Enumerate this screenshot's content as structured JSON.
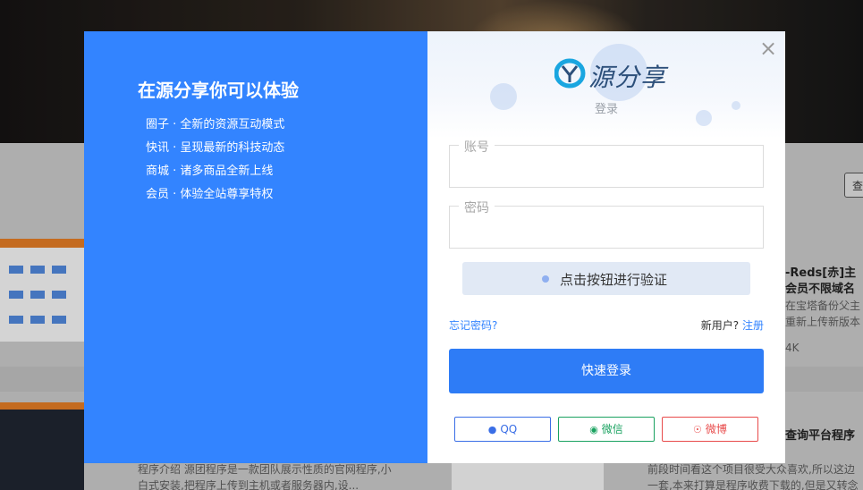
{
  "background": {
    "right_title_1": "-Reds[赤]主",
    "right_title_1b": "会员不限域名",
    "right_snippet_1": "在宝塔备份父主",
    "right_snippet_1b": "重新上传新版本",
    "right_stat": "4K",
    "right_title_2": "查询平台程序",
    "bottom_text_left_1": "程序介绍 源团程序是一款团队展示性质的官网程序,小",
    "bottom_text_left_2": "白式安装,把程序上传到主机或者服务器内,设...",
    "bottom_text_right_1": "前段时间看这个项目很受大众喜欢,所以这边",
    "bottom_text_right_2": "一套,本来打算是程序收费下载的,但是又转念",
    "search_btn": "查"
  },
  "promo": {
    "title": "在源分享你可以体验",
    "features": [
      "圈子 · 全新的资源互动模式",
      "快讯 · 呈现最新的科技动态",
      "商城 · 诸多商品全新上线",
      "会员 · 体验全站尊享特权"
    ]
  },
  "form": {
    "close_symbol": "×",
    "logo_text": "源分享",
    "caption": "登录",
    "account_label": "账号",
    "account_value": "",
    "password_label": "密码",
    "password_value": "",
    "verify_label": "点击按钮进行验证",
    "forgot_label": "忘记密码?",
    "new_user_label": "新用户?",
    "register_label": "注册",
    "submit_label": "快速登录",
    "social": {
      "qq": "QQ",
      "wechat": "微信",
      "weibo": "微博"
    }
  },
  "colors": {
    "accent": "#3384ff",
    "primary_button": "#2e7cf6",
    "qq": "#3a6ee6",
    "wechat": "#1aa260",
    "weibo": "#e84a4a"
  }
}
